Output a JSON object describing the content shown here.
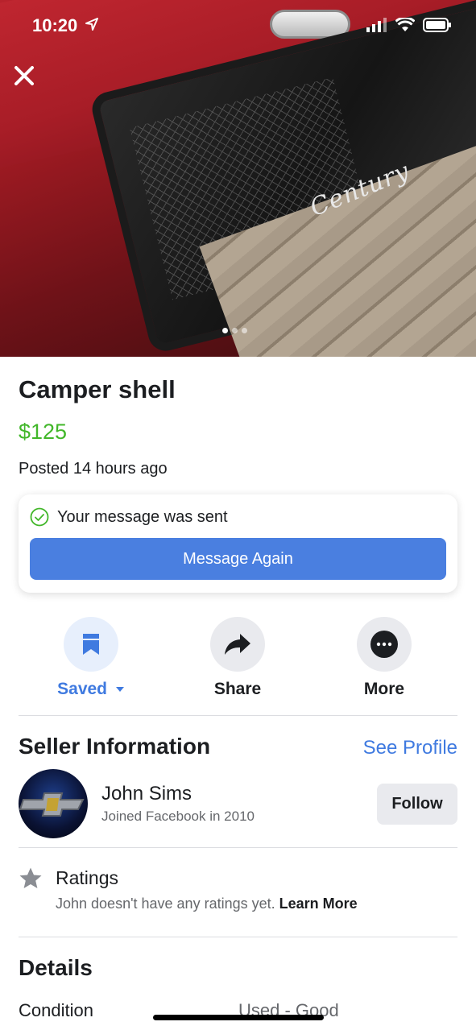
{
  "status_bar": {
    "time": "10:20"
  },
  "listing": {
    "title": "Camper shell",
    "price": "$125",
    "posted": "Posted 14 hours ago",
    "photo_brand_text": "Century",
    "photo_count": 3,
    "photo_index": 1
  },
  "message": {
    "status": "Your message was sent",
    "button_label": "Message Again"
  },
  "actions": [
    {
      "label": "Saved",
      "icon": "bookmark-icon"
    },
    {
      "label": "Share",
      "icon": "share-arrow-icon"
    },
    {
      "label": "More",
      "icon": "more-dots-icon"
    }
  ],
  "seller": {
    "heading": "Seller Information",
    "see_profile": "See Profile",
    "name": "John Sims",
    "joined": "Joined Facebook in 2010",
    "follow_label": "Follow"
  },
  "ratings": {
    "heading": "Ratings",
    "message": "John doesn't have any ratings yet.",
    "learn_more": "Learn More"
  },
  "details": {
    "heading": "Details",
    "condition_label": "Condition",
    "condition_value": "Used - Good"
  },
  "colors": {
    "accent_blue": "#4a7fe0",
    "price_green": "#42b72a",
    "link_blue": "#3f7ae0"
  }
}
